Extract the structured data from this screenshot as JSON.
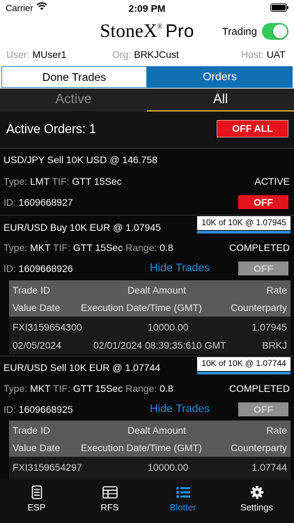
{
  "status_bar": {
    "carrier": "Carrier",
    "time": "2:09 PM"
  },
  "header": {
    "brand": "StoneX",
    "brand_mark": "®",
    "brand_suffix": "Pro",
    "trading_label": "Trading",
    "trading_on": true,
    "user_label": "User:",
    "user": "MUser1",
    "org_label": "Org:",
    "org": "BRKJCust",
    "host_label": "Host:",
    "host": "UAT"
  },
  "tabs": {
    "done_trades": "Done Trades",
    "orders": "Orders"
  },
  "subtabs": {
    "active": "Active",
    "all": "All"
  },
  "summary": {
    "title": "Active Orders: 1",
    "off_all": "OFF ALL"
  },
  "orders": [
    {
      "title": "USD/JPY Sell 10K USD @ 146.758",
      "type_label": "Type:",
      "type": "LMT",
      "tif_label": "TIF:",
      "tif": "GTT 15Sec",
      "status": "ACTIVE",
      "id_label": "ID:",
      "id": "1609668927",
      "off_label": "OFF"
    },
    {
      "title": "EUR/USD Buy 10K EUR @ 1.07945",
      "fill": "10K of 10K @ 1.07945",
      "fill_progress": 1.0,
      "type_label": "Type:",
      "type": "MKT",
      "tif_label": "TIF:",
      "tif": "GTT 15Sec",
      "range_label": "Range:",
      "range": "0.8",
      "status": "COMPLETED",
      "id_label": "ID:",
      "id": "1609668926",
      "hide_trades": "Hide Trades",
      "off_label": "OFF",
      "trade_headers": [
        "Trade ID",
        "Dealt Amount",
        "Rate",
        "Value Date",
        "Execution Date/Time (GMT)",
        "Counterparty"
      ],
      "trades": [
        {
          "trade_id": "FXI3159654300",
          "dealt_amount": "10000.00",
          "rate": "1.07945",
          "value_date": "02/05/2024",
          "exec_time": "02/01/2024 08:39:35:610 GMT",
          "counterparty": "BRKJ"
        }
      ]
    },
    {
      "title": "EUR/USD Sell 10K EUR @ 1.07744",
      "fill": "10K of 10K @ 1.07744",
      "fill_progress": 1.0,
      "type_label": "Type:",
      "type": "MKT",
      "tif_label": "TIF:",
      "tif": "GTT 15Sec",
      "range_label": "Range:",
      "range": "0.8",
      "status": "COMPLETED",
      "id_label": "ID:",
      "id": "1609668925",
      "hide_trades": "Hide Trades",
      "off_label": "OFF",
      "trade_headers": [
        "Trade ID",
        "Dealt Amount",
        "Rate",
        "Value Date",
        "Execution Date/Time (GMT)",
        "Counterparty"
      ],
      "trades": [
        {
          "trade_id": "FXI3159654297",
          "dealt_amount": "10000.00",
          "rate": "1.07744"
        }
      ]
    }
  ],
  "tabbar": [
    {
      "label": "ESP",
      "icon": "esp-icon",
      "selected": false
    },
    {
      "label": "RFS",
      "icon": "rfs-icon",
      "selected": false
    },
    {
      "label": "Blotter",
      "icon": "blotter-list-icon",
      "selected": true
    },
    {
      "label": "Settings",
      "icon": "gear-icon",
      "selected": false
    }
  ],
  "colors": {
    "accent_blue": "#1170b4",
    "off_red": "#e5141c",
    "toggle_green": "#34c759",
    "link_blue": "#1e8fe0"
  }
}
